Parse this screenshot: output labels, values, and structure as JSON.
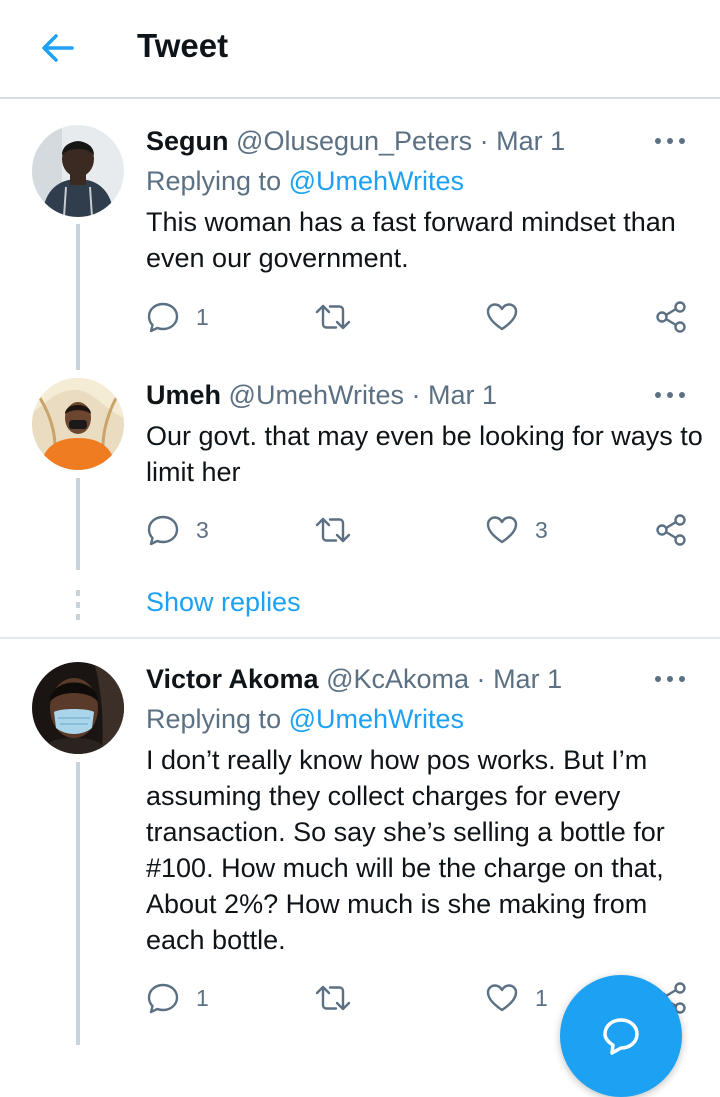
{
  "header": {
    "title": "Tweet",
    "back_icon": "arrow-left-icon",
    "accent_color": "#1da1f2"
  },
  "tweets": [
    {
      "name": "Segun",
      "handle": "@Olusegun_Peters",
      "separator": "·",
      "date": "Mar 1",
      "replying_label": "Replying to",
      "replying_handle": "@UmehWrites",
      "text": "This woman has a fast forward mindset than even our government.",
      "reply_count": "1",
      "retweet_count": "",
      "like_count": ""
    },
    {
      "name": "Umeh",
      "handle": "@UmehWrites",
      "separator": "·",
      "date": "Mar 1",
      "text": "Our govt. that may even be looking for ways to limit her",
      "reply_count": "3",
      "retweet_count": "",
      "like_count": "3"
    },
    {
      "name": "Victor Akoma",
      "handle": "@KcAkoma",
      "separator": "·",
      "date": "Mar 1",
      "replying_label": "Replying to",
      "replying_handle": "@UmehWrites",
      "text": "I don’t really know how pos works. But I’m assuming they collect charges for every transaction. So say she’s selling a bottle for #100. How much will be the charge on that, About 2%? How much is she making from each bottle.",
      "reply_count": "1",
      "retweet_count": "",
      "like_count": "1"
    }
  ],
  "show_replies": "Show replies",
  "fab_icon": "compose-reply-icon"
}
